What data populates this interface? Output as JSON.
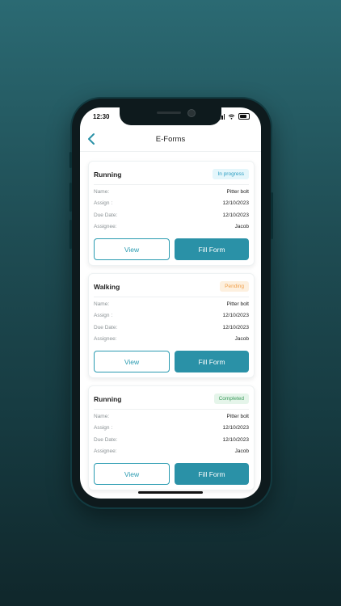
{
  "status": {
    "time": "12:30"
  },
  "header": {
    "title": "E-Forms"
  },
  "labels": {
    "name": "Name:",
    "assign": "Assign :",
    "due_date": "Due Date:",
    "assignee": "Assignee:"
  },
  "cards": [
    {
      "title": "Running",
      "status": "In progress",
      "status_type": "progress",
      "name": "Pitter bolt",
      "assign": "12/10/2023",
      "due_date": "12/10/2023",
      "assignee": "Jacob",
      "view_label": "View",
      "fill_label": "Fill Form"
    },
    {
      "title": "Walking",
      "status": "Pending",
      "status_type": "pending",
      "name": "Pitter bolt",
      "assign": "12/10/2023",
      "due_date": "12/10/2023",
      "assignee": "Jacob",
      "view_label": "View",
      "fill_label": "Fill Form"
    },
    {
      "title": "Running",
      "status": "Completed",
      "status_type": "completed",
      "name": "Pitter bolt",
      "assign": "12/10/2023",
      "due_date": "12/10/2023",
      "assignee": "Jacob",
      "view_label": "View",
      "fill_label": "Fill Form"
    }
  ],
  "colors": {
    "accent": "#2a91a7",
    "background_top": "#2b6a73",
    "background_bottom": "#10272b"
  },
  "icons": {
    "back": "chevron-left-icon",
    "signal": "signal-icon",
    "wifi": "wifi-icon",
    "battery": "battery-icon"
  }
}
